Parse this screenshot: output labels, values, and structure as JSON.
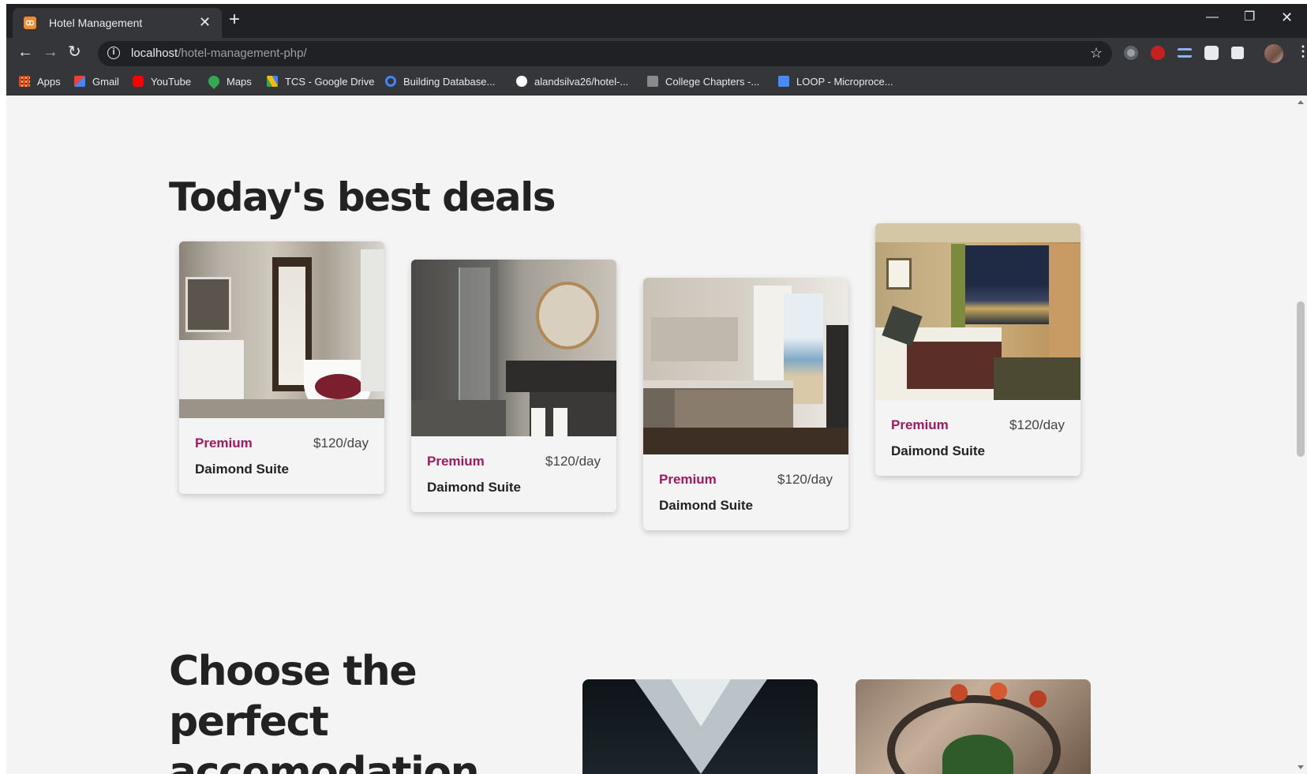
{
  "browser": {
    "tab": {
      "title": "Hotel Management",
      "close": "✕"
    },
    "new_tab": "+",
    "window": {
      "minimize": "—",
      "maximize": "❐",
      "close": "✕"
    },
    "nav": {
      "back": "←",
      "forward": "→",
      "reload": "↻"
    },
    "address": {
      "host": "localhost",
      "path": "/hotel-management-php/"
    },
    "star": "☆",
    "menu": "⋮",
    "bookmarks": [
      {
        "label": "Apps",
        "icon": "apps-grid-icon",
        "color": "#ea4335"
      },
      {
        "label": "Gmail",
        "icon": "gmail-icon",
        "color": "#ea4335"
      },
      {
        "label": "YouTube",
        "icon": "youtube-icon",
        "color": "#ff0000"
      },
      {
        "label": "Maps",
        "icon": "maps-pin-icon",
        "color": "#34a853"
      },
      {
        "label": "TCS - Google Drive",
        "icon": "google-drive-icon",
        "color": "#fbbc04"
      },
      {
        "label": "Building Database...",
        "icon": "infinity-icon",
        "color": "#4285f4"
      },
      {
        "label": "alandsilva26/hotel-...",
        "icon": "github-icon",
        "color": "#ffffff"
      },
      {
        "label": "College Chapters -...",
        "icon": "cc-icon",
        "color": "#bbbbbb"
      },
      {
        "label": "LOOP - Microproce...",
        "icon": "loop-doc-icon",
        "color": "#4a8af4"
      }
    ]
  },
  "page": {
    "deals_title": "Today's best deals",
    "cards": [
      {
        "tier": "Premium",
        "price": "$120/day",
        "name": "Daimond Suite",
        "image": "bathroom-photo"
      },
      {
        "tier": "Premium",
        "price": "$120/day",
        "name": "Daimond Suite",
        "image": "bathroom-mirror-photo"
      },
      {
        "tier": "Premium",
        "price": "$120/day",
        "name": "Daimond Suite",
        "image": "bedroom-balcony-photo"
      },
      {
        "tier": "Premium",
        "price": "$120/day",
        "name": "Daimond Suite",
        "image": "hotel-room-night-photo"
      }
    ],
    "accommodation_title": "Choose the perfect accomodation"
  },
  "colors": {
    "accent": "#a2185e",
    "page_bg": "#f4f4f4",
    "chrome_dark": "#202124",
    "chrome_toolbar": "#35363a"
  }
}
